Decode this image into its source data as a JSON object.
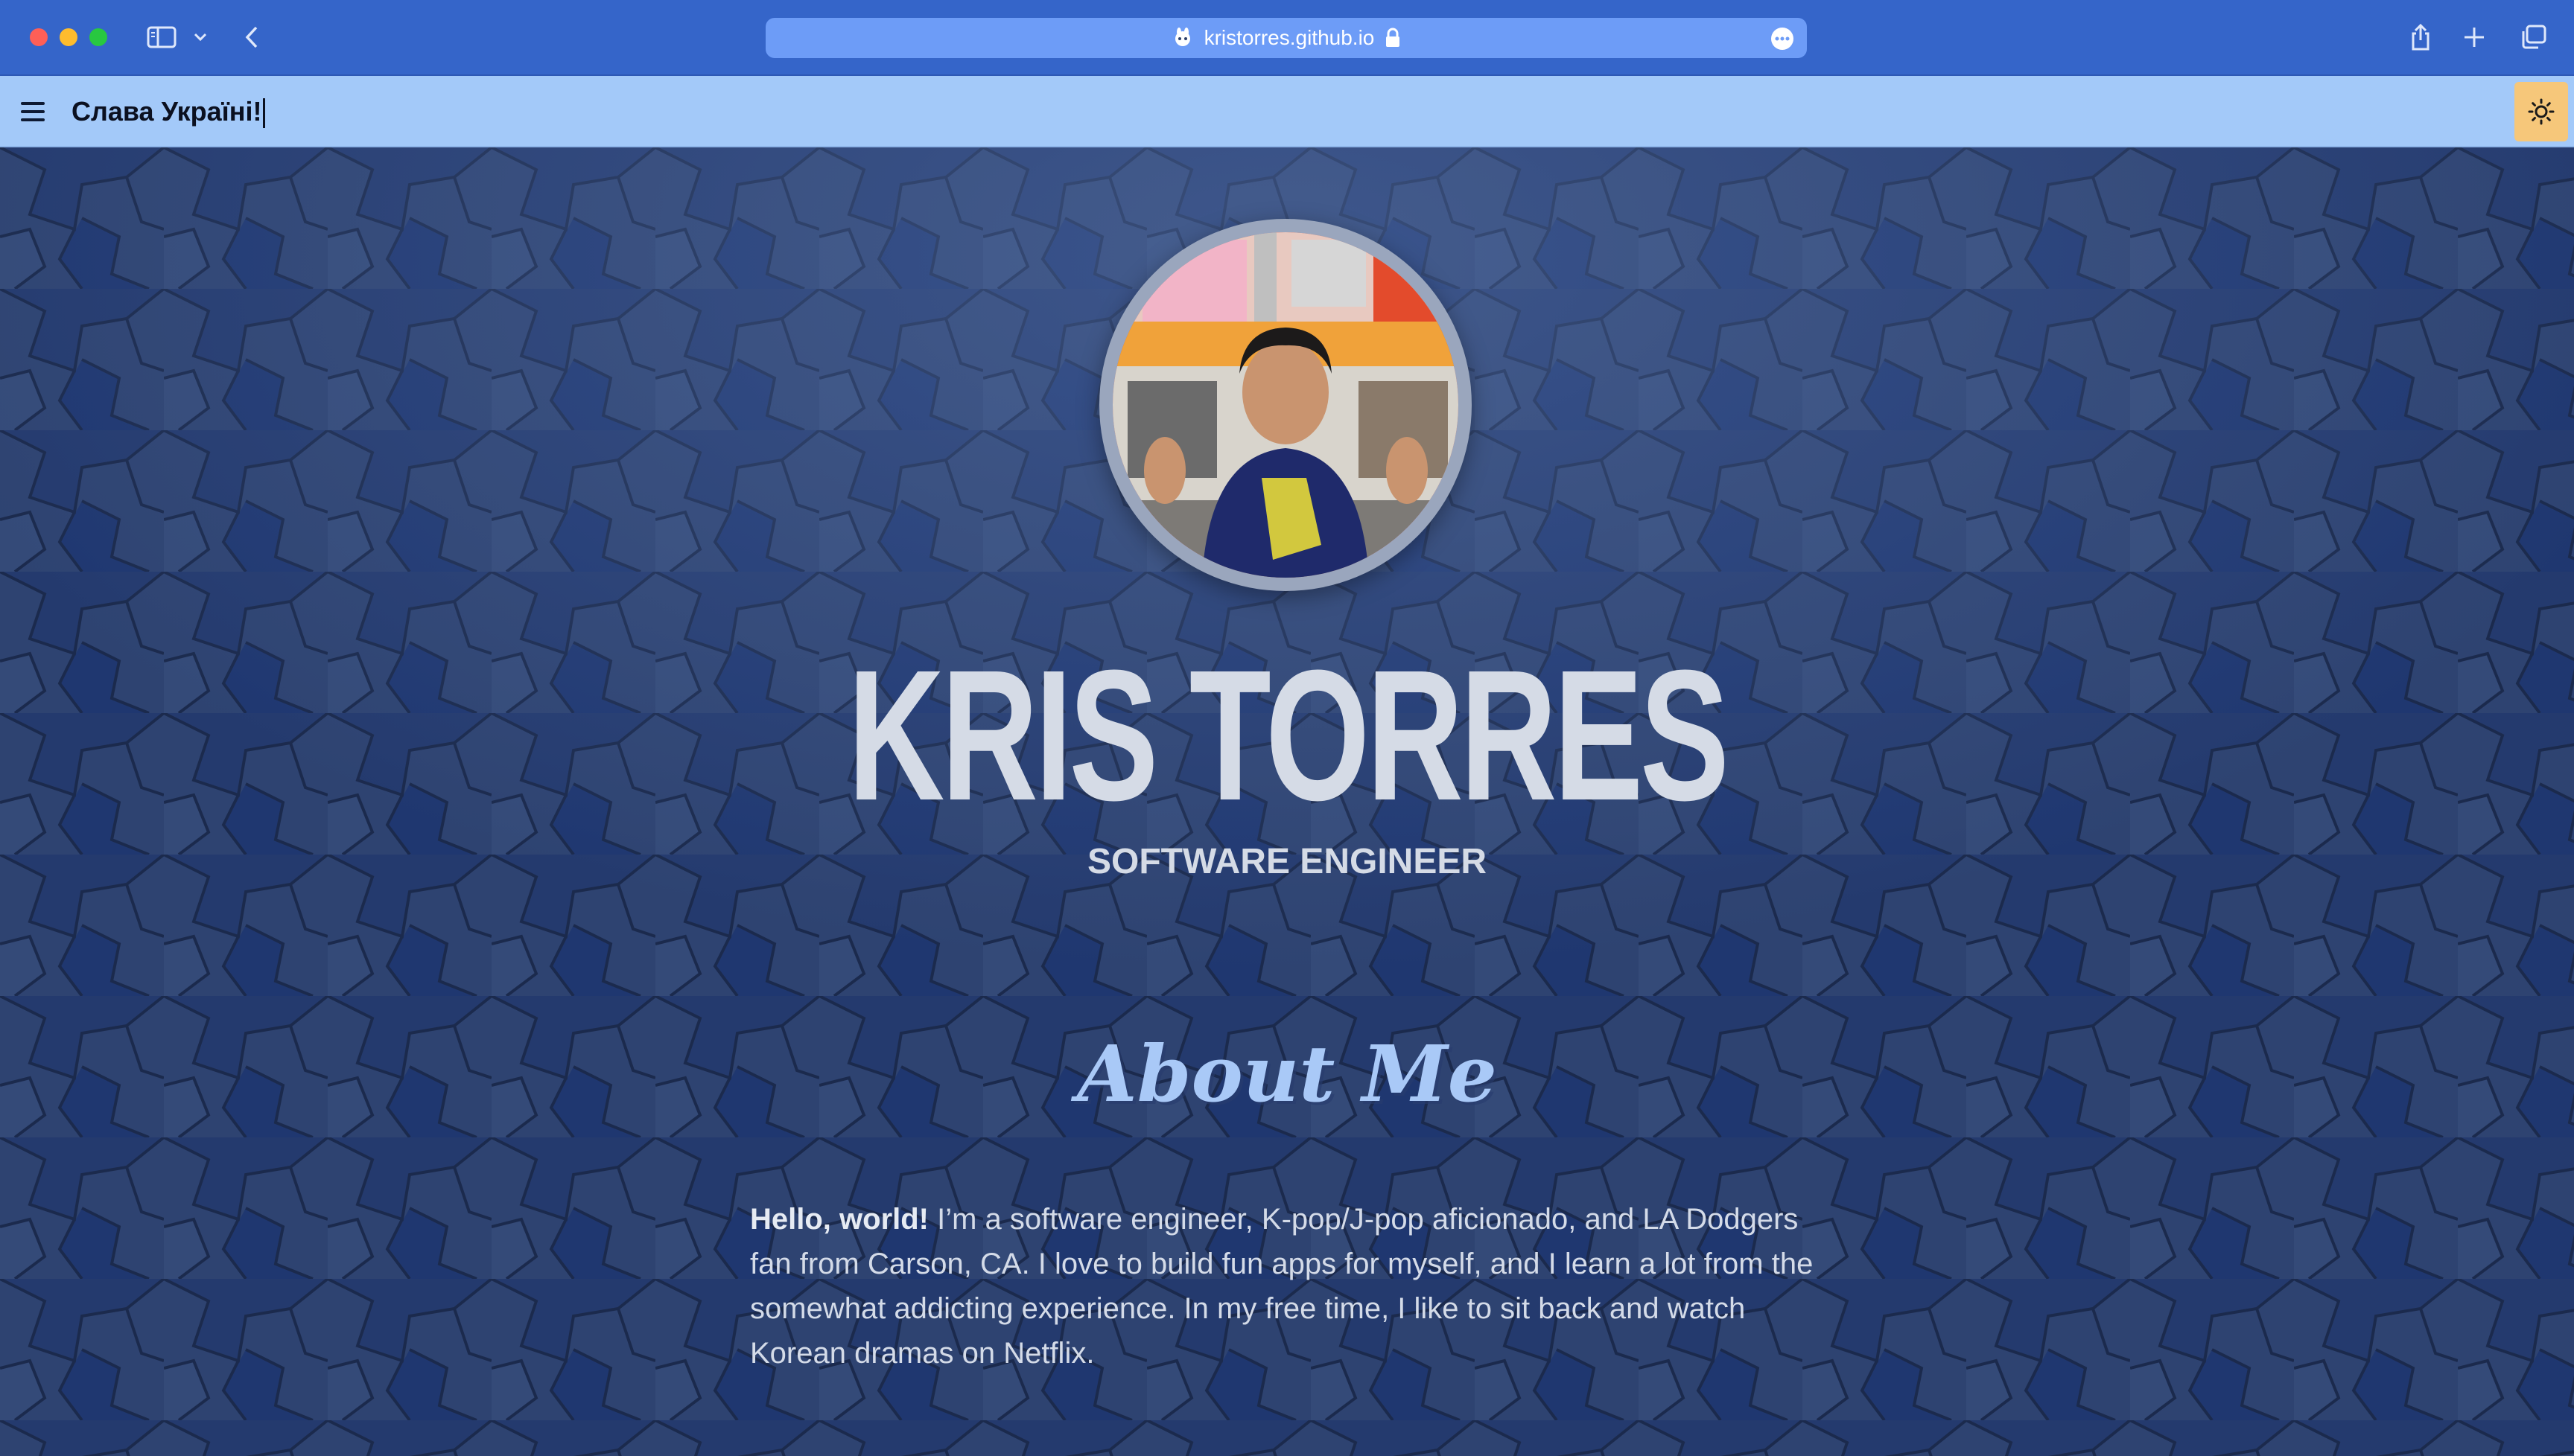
{
  "browser": {
    "url": "kristorres.github.io"
  },
  "header": {
    "title": "Слава Україні!"
  },
  "hero": {
    "name": "KRIS TORRES",
    "role": "SOFTWARE ENGINEER",
    "photo_alt": "Kris Torres"
  },
  "about": {
    "heading": "About Me",
    "greeting": "Hello, world!",
    "body": " I’m a software engineer, K-pop/J-pop aficionado, and LA Dodgers fan from Carson, CA. I love to build fun apps for myself, and I learn a lot from the somewhat addicting experience. In my free time, I like to sit back and watch Korean dramas on Netflix."
  },
  "colors": {
    "chrome": "#3565c9",
    "header_bar": "#a3c9f9",
    "page_background": "#2b3f6b",
    "tile_dark": "#1f3a72",
    "heading_accent": "#a9c9f7",
    "theme_toggle": "#f6c77a"
  }
}
